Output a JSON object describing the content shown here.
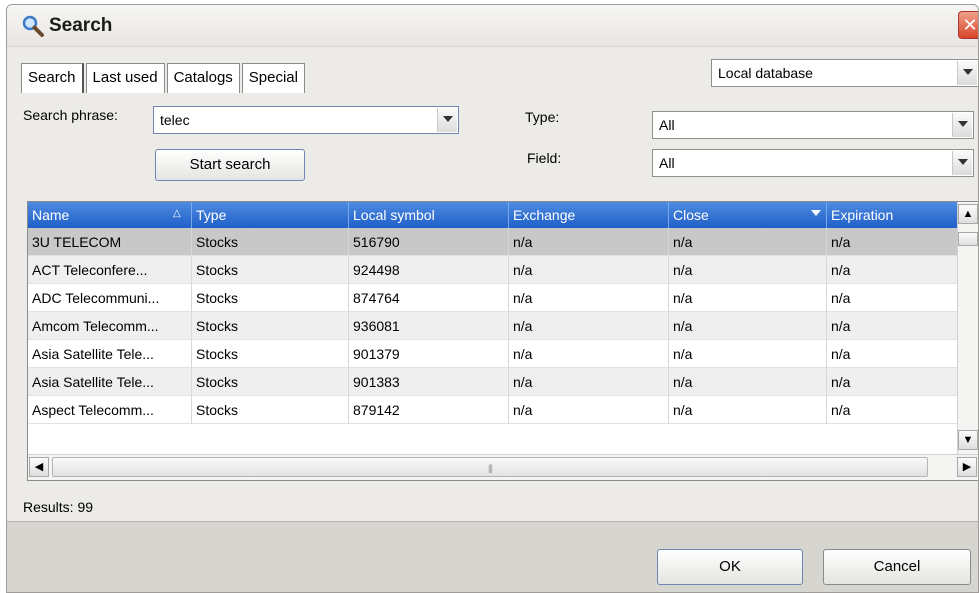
{
  "window": {
    "title": "Search"
  },
  "tabs": [
    {
      "label": "Search"
    },
    {
      "label": "Last used"
    },
    {
      "label": "Catalogs"
    },
    {
      "label": "Special"
    }
  ],
  "source": {
    "value": "Local database"
  },
  "search": {
    "phrase_label": "Search phrase:",
    "phrase_value": "telec",
    "start_label": "Start search",
    "type_label": "Type:",
    "type_value": "All",
    "field_label": "Field:",
    "field_value": "All"
  },
  "grid": {
    "columns": [
      "Name",
      "Type",
      "Local symbol",
      "Exchange",
      "Close",
      "Expiration"
    ],
    "rows": [
      [
        "3U TELECOM",
        "Stocks",
        "516790",
        "n/a",
        "n/a",
        "n/a"
      ],
      [
        "ACT Teleconfere...",
        "Stocks",
        "924498",
        "n/a",
        "n/a",
        "n/a"
      ],
      [
        "ADC Telecommuni...",
        "Stocks",
        "874764",
        "n/a",
        "n/a",
        "n/a"
      ],
      [
        "Amcom Telecomm...",
        "Stocks",
        "936081",
        "n/a",
        "n/a",
        "n/a"
      ],
      [
        "Asia Satellite Tele...",
        "Stocks",
        "901379",
        "n/a",
        "n/a",
        "n/a"
      ],
      [
        "Asia Satellite Tele...",
        "Stocks",
        "901383",
        "n/a",
        "n/a",
        "n/a"
      ],
      [
        "Aspect Telecomm...",
        "Stocks",
        "879142",
        "n/a",
        "n/a",
        "n/a"
      ]
    ]
  },
  "results": {
    "text": "Results: 99"
  },
  "buttons": {
    "ok": "OK",
    "cancel": "Cancel"
  },
  "colors": {
    "header_blue": "#2a6bd0",
    "close_red": "#d8452a",
    "selected_row": "#c8c8c8"
  }
}
